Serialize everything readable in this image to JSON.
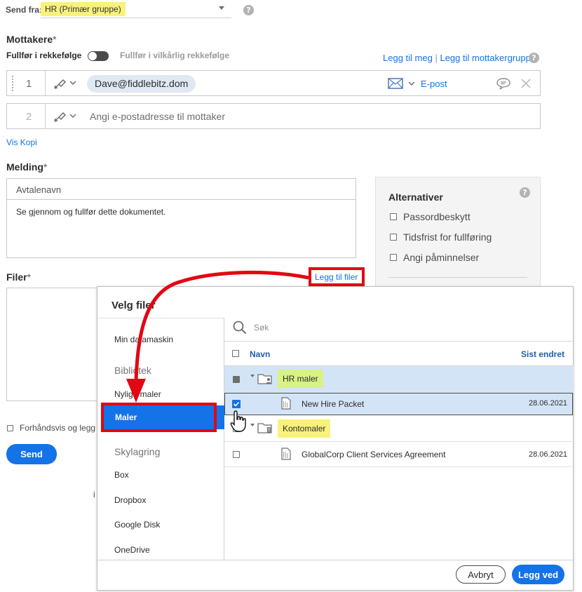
{
  "sender": {
    "label": "Send fra:",
    "value": "HR (Primær gruppe)"
  },
  "recipients": {
    "title": "Mottakere",
    "required_mark": "*",
    "order_label": "Fullfør i rekkefølge",
    "any_order_label": "Fullfør i vilkårlig rekkefølge",
    "add_me": "Legg til meg",
    "separator": "|",
    "add_group": "Legg til mottakergruppe",
    "rows": [
      {
        "number": "1",
        "email": "Dave@fiddlebitz.dom",
        "delivery": "E-post"
      },
      {
        "number": "2",
        "placeholder": "Angi e-postadresse til mottaker"
      }
    ],
    "show_cc": "Vis Kopi"
  },
  "message": {
    "title": "Melding",
    "required_mark": "*",
    "agreement_name_placeholder": "Avtalenavn",
    "body_text": "Se gjennom og fullfør dette dokumentet."
  },
  "options": {
    "title": "Alternativer",
    "items": [
      "Passordbeskytt",
      "Tidsfrist for fullføring",
      "Angi påminnelser"
    ]
  },
  "files": {
    "title": "Filer",
    "required_mark": "*",
    "add_files": "Legg til filer"
  },
  "preview_label": "Forhåndsvis og legg",
  "send_button": "Send",
  "bottom_fragment": "i",
  "help_glyph": "?",
  "dialog": {
    "title": "Velg filer",
    "nav": {
      "my_computer": "Min datamaskin",
      "library": "Bibliotek",
      "recent_templates": "Nylige maler",
      "templates": "Maler",
      "cloud": "Skylagring",
      "cloud_items": [
        "Box",
        "Dropbox",
        "Google Disk",
        "OneDrive"
      ]
    },
    "search_placeholder": "Søk",
    "col_name": "Navn",
    "col_modified": "Sist endret",
    "rows": [
      {
        "kind": "folder",
        "name": "HR maler"
      },
      {
        "kind": "file",
        "name": "New Hire Packet",
        "date": "28.06.2021"
      },
      {
        "kind": "folder",
        "name": "Kontomaler"
      },
      {
        "kind": "file",
        "name": "GlobalCorp Client Services Agreement",
        "date": "28.06.2021"
      }
    ],
    "cancel": "Avbryt",
    "attach": "Legg ved"
  },
  "colors": {
    "accent": "#1473e6",
    "annotation_red": "#e30613",
    "highlight_yellow": "#f8f27a",
    "highlight_green": "#d8f283",
    "selected_row": "#d4e4f7"
  }
}
